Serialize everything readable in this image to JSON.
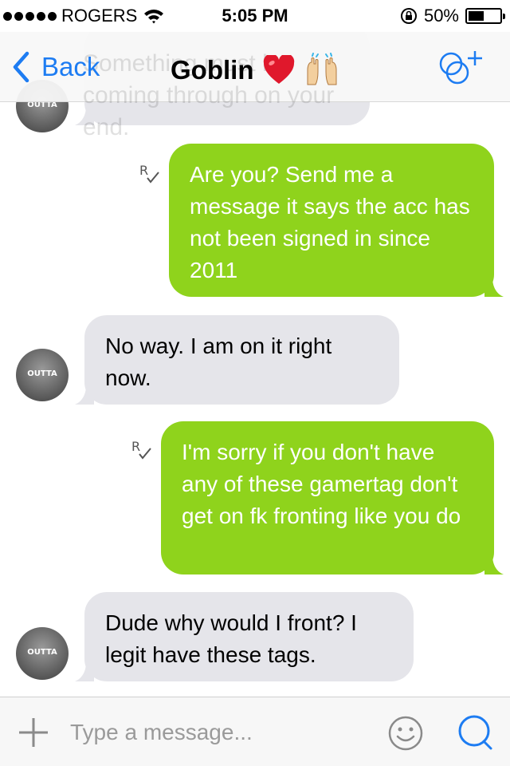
{
  "status_bar": {
    "carrier": "ROGERS",
    "time": "5:05 PM",
    "battery": "50%",
    "battery_level": 0.5
  },
  "nav": {
    "back_label": "Back",
    "title": "Goblin",
    "ghost_text": "Something must be coming through on your end."
  },
  "messages": [
    {
      "direction": "in",
      "text": "",
      "avatar_text": "OUTTA"
    },
    {
      "direction": "out",
      "text": "Are you? Send me a message it says the acc has not been signed in since 2011",
      "read_marker": "R"
    },
    {
      "direction": "in",
      "text": "No way. I am on it right now.",
      "avatar_text": "OUTTA"
    },
    {
      "direction": "out",
      "text": "I'm sorry if you don't have any of these gamertag don't get on fk fronting like you do",
      "read_marker": "R"
    },
    {
      "direction": "in",
      "text": "Dude why would I front? I legit have these tags.",
      "avatar_text": "OUTTA"
    }
  ],
  "input": {
    "placeholder": "Type a message..."
  },
  "colors": {
    "accent": "#1d7cf2",
    "outgoing_bubble": "#8fd31c",
    "incoming_bubble": "#e5e5ea"
  },
  "icons": {
    "back": "chevron-left-icon",
    "title_emoji_1": "red-heart-icon",
    "title_emoji_2": "raised-hands-icon",
    "add": "add-participant-icon",
    "read": "read-receipt-icon",
    "plus": "plus-icon",
    "emoji": "smiley-icon",
    "send": "chat-bubble-icon"
  }
}
